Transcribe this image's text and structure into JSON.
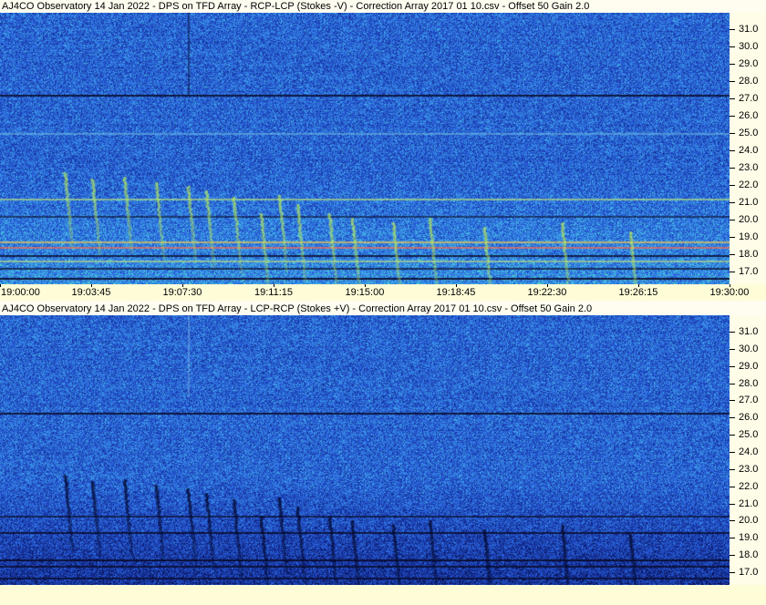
{
  "panels": [
    {
      "title": "AJ4CO Observatory 14 Jan 2022  -  DPS on TFD Array  -  RCP-LCP (Stokes -V)  -  Correction Array 2017 01 10.csv  -  Offset 50  Gain 2.0",
      "polarity": "bright"
    },
    {
      "title": "AJ4CO Observatory 14 Jan 2022  -  DPS on TFD Array  -  LCP-RCP (Stokes +V)  -  Correction Array 2017 01 10.csv  -  Offset 50  Gain 2.0",
      "polarity": "dark"
    }
  ],
  "y_axis_labels": [
    "31.0",
    "30.0",
    "29.0",
    "28.0",
    "27.0",
    "26.0",
    "25.0",
    "24.0",
    "23.0",
    "22.0",
    "21.0",
    "20.0",
    "19.0",
    "18.0",
    "17.0"
  ],
  "x_axis_labels": [
    "19:00:00",
    "19:03:45",
    "19:07:30",
    "19:11:15",
    "19:15:00",
    "19:18:45",
    "19:22:30",
    "19:26:15",
    "19:30:00"
  ],
  "colors": {
    "background_field": "#2a5ad0",
    "axis_background": "#fffcd8"
  }
}
